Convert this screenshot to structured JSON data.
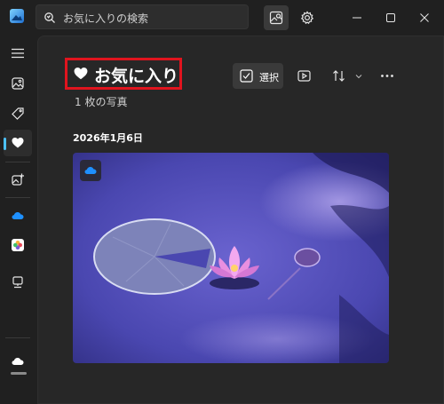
{
  "search": {
    "placeholder": "お気に入りの検索"
  },
  "page": {
    "title": "お気に入り",
    "count": "1 枚の写真",
    "date_group": "2026年1月6日"
  },
  "toolbar": {
    "select_label": "選択"
  },
  "icons": {
    "app": "photos-app-icon",
    "search": "search-icon",
    "image_search": "image-search-icon",
    "settings": "gear-icon",
    "minimize": "minimize-icon",
    "maximize": "maximize-icon",
    "close": "close-icon",
    "menu": "hamburger-icon",
    "gallery": "gallery-icon",
    "tags": "tag-icon",
    "favorites": "heart-icon",
    "create": "create-icon",
    "onedrive": "onedrive-icon",
    "icloud": "icloud-photos-icon",
    "device": "pc-icon",
    "cloud": "cloud-icon",
    "slideshow": "slideshow-icon",
    "sort": "sort-icon",
    "more": "more-icon"
  },
  "colors": {
    "background": "#202020",
    "content": "#272727",
    "accent": "#4cc2ff",
    "highlight_border": "#e0141e"
  }
}
